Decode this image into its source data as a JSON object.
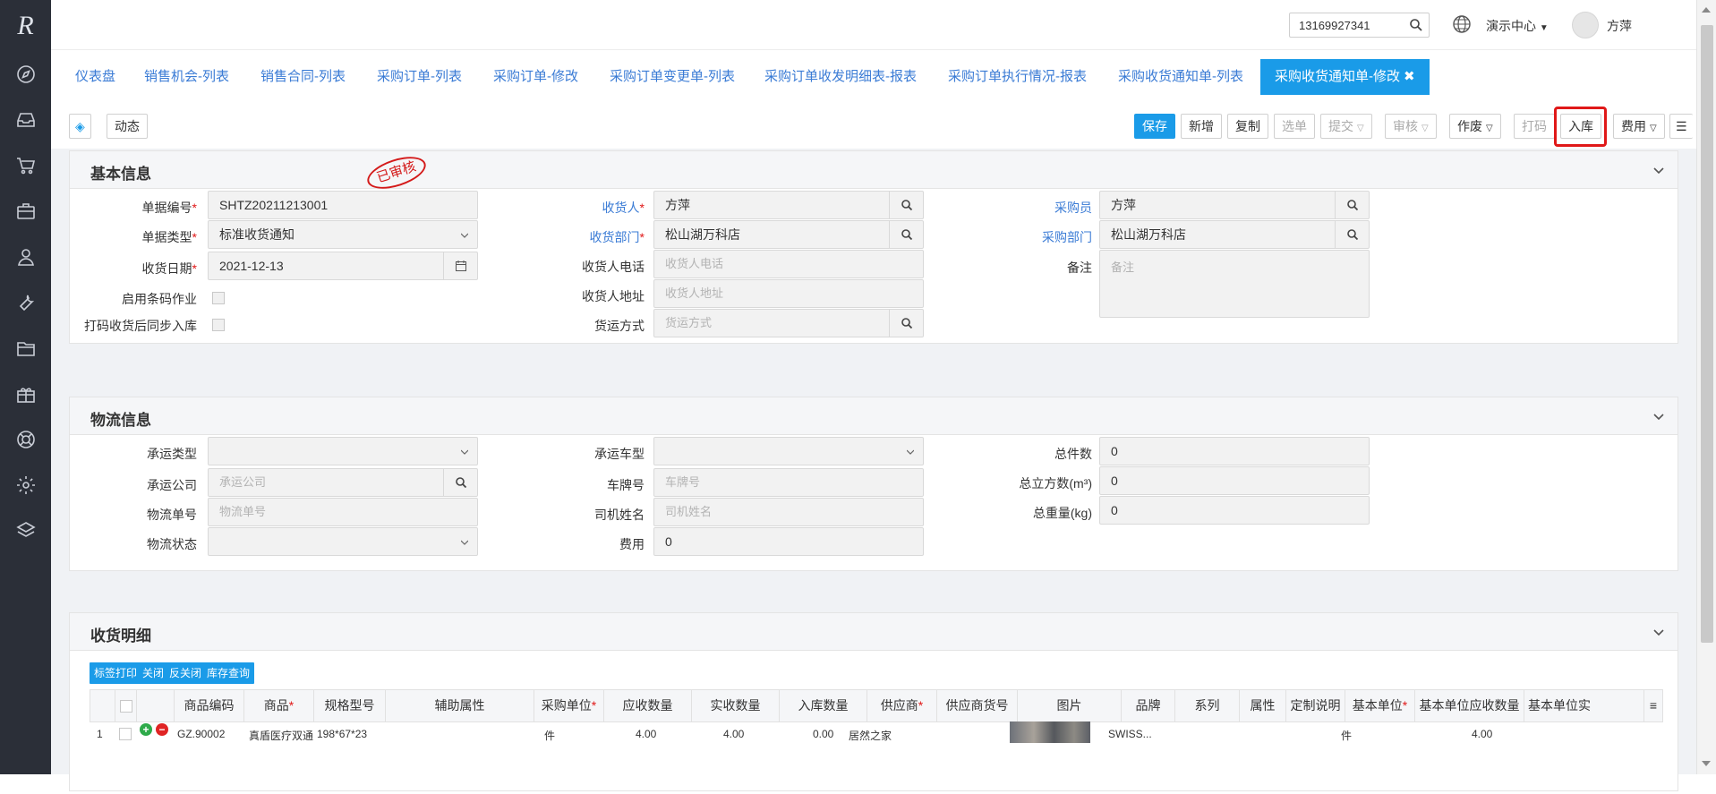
{
  "app": {
    "logo": "R"
  },
  "sidebar": {
    "icons": [
      "compass-icon",
      "inbox-icon",
      "cart-icon",
      "briefcase-icon",
      "user-icon",
      "wrench-icon",
      "folder-icon",
      "gift-icon",
      "support-icon",
      "gear-icon",
      "layers-icon"
    ]
  },
  "topbar": {
    "search_value": "13169927341",
    "center_label": "演示中心",
    "user_name": "方萍"
  },
  "tabs": [
    {
      "label": "仪表盘"
    },
    {
      "label": "销售机会-列表"
    },
    {
      "label": "销售合同-列表"
    },
    {
      "label": "采购订单-列表"
    },
    {
      "label": "采购订单-修改"
    },
    {
      "label": "采购订单变更单-列表"
    },
    {
      "label": "采购订单收发明细表-报表"
    },
    {
      "label": "采购订单执行情况-报表"
    },
    {
      "label": "采购收货通知单-列表"
    },
    {
      "label": "采购收货通知单-修改",
      "close": "✖"
    }
  ],
  "toolbar": {
    "dynamic": "动态",
    "save": "保存",
    "new": "新增",
    "copy": "复制",
    "select": "选单",
    "submit": "提交",
    "review": "审核",
    "void": "作废",
    "print": "打码",
    "instock": "入库",
    "fee": "费用"
  },
  "basic": {
    "title": "基本信息",
    "stamp": "已审核",
    "doc_no_label": "单据编号",
    "doc_no": "SHTZ20211213001",
    "doc_type_label": "单据类型",
    "doc_type": "标准收货通知",
    "recv_date_label": "收货日期",
    "recv_date": "2021-12-13",
    "barcode_label": "启用条码作业",
    "sync_label": "打码收货后同步入库",
    "receiver_label": "收货人",
    "receiver": "方萍",
    "recv_dept_label": "收货部门",
    "recv_dept": "松山湖万科店",
    "recv_phone_label": "收货人电话",
    "recv_phone_ph": "收货人电话",
    "recv_addr_label": "收货人地址",
    "recv_addr_ph": "收货人地址",
    "ship_method_label": "货运方式",
    "ship_method_ph": "货运方式",
    "buyer_label": "采购员",
    "buyer": "方萍",
    "buy_dept_label": "采购部门",
    "buy_dept": "松山湖万科店",
    "remark_label": "备注",
    "remark_ph": "备注"
  },
  "logistics": {
    "title": "物流信息",
    "carrier_type_label": "承运类型",
    "carrier_company_label": "承运公司",
    "carrier_company_ph": "承运公司",
    "tracking_label": "物流单号",
    "tracking_ph": "物流单号",
    "status_label": "物流状态",
    "vehicle_type_label": "承运车型",
    "plate_label": "车牌号",
    "plate_ph": "车牌号",
    "driver_label": "司机姓名",
    "driver_ph": "司机姓名",
    "fee_label": "费用",
    "fee": "0",
    "total_pieces_label": "总件数",
    "total_pieces": "0",
    "total_volume_label": "总立方数(m³)",
    "total_volume": "0",
    "total_weight_label": "总重量(kg)",
    "total_weight": "0"
  },
  "detail": {
    "title": "收货明细",
    "buttons": [
      "标签打印",
      "关闭",
      "反关闭",
      "库存查询"
    ],
    "columns": [
      {
        "label": "商品编码",
        "req": false
      },
      {
        "label": "商品",
        "req": true
      },
      {
        "label": "规格型号",
        "req": false
      },
      {
        "label": "辅助属性",
        "req": false
      },
      {
        "label": "采购单位",
        "req": true
      },
      {
        "label": "应收数量",
        "req": false
      },
      {
        "label": "实收数量",
        "req": false
      },
      {
        "label": "入库数量",
        "req": false
      },
      {
        "label": "供应商",
        "req": true
      },
      {
        "label": "供应商货号",
        "req": false
      },
      {
        "label": "图片",
        "req": false
      },
      {
        "label": "品牌",
        "req": false
      },
      {
        "label": "系列",
        "req": false
      },
      {
        "label": "属性",
        "req": false
      },
      {
        "label": "定制说明",
        "req": false
      },
      {
        "label": "基本单位",
        "req": true
      },
      {
        "label": "基本单位应收数量",
        "req": false
      },
      {
        "label": "基本单位实",
        "req": false
      }
    ],
    "row": {
      "index": "1",
      "code": "GZ.90002",
      "name": "真盾医疗双通",
      "spec": "198*67*23",
      "unit": "件",
      "due_qty": "4.00",
      "recv_qty": "4.00",
      "in_qty": "0.00",
      "supplier": "居然之家",
      "brand": "SWISS...",
      "base_unit": "件",
      "base_due_qty": "4.00"
    }
  }
}
